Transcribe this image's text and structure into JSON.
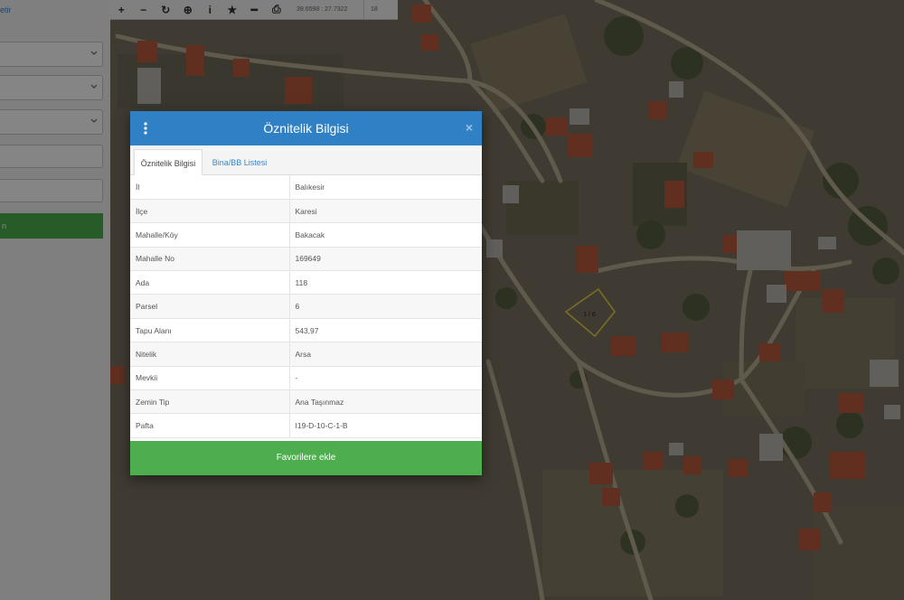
{
  "sidebar": {
    "link_label": "etir",
    "action_label": "n"
  },
  "toolbar": {
    "buttons": [
      {
        "name": "zoom-in-button",
        "glyph": "+"
      },
      {
        "name": "zoom-out-button",
        "glyph": "−"
      },
      {
        "name": "refresh-button",
        "glyph": "↻"
      },
      {
        "name": "locate-button",
        "glyph": "⊕"
      },
      {
        "name": "info-button",
        "glyph": "i"
      },
      {
        "name": "favorite-button",
        "glyph": "★"
      },
      {
        "name": "measure-button",
        "glyph": "━"
      },
      {
        "name": "print-button",
        "glyph": "⎙"
      }
    ],
    "coordinates": "39.6598 : 27.7322",
    "zoom_level": "18"
  },
  "map": {
    "parcel_label": "1 / 6"
  },
  "modal": {
    "title": "Öznitelik Bilgisi",
    "close_glyph": "×",
    "tabs": [
      {
        "label": "Öznitelik Bilgisi",
        "active": true
      },
      {
        "label": "Bina/BB Listesi",
        "active": false
      }
    ],
    "rows": [
      {
        "key": "İl",
        "value": "Balıkesir"
      },
      {
        "key": "İlçe",
        "value": "Karesi"
      },
      {
        "key": "Mahalle/Köy",
        "value": "Bakacak"
      },
      {
        "key": "Mahalle No",
        "value": "169649"
      },
      {
        "key": "Ada",
        "value": "118"
      },
      {
        "key": "Parsel",
        "value": "6"
      },
      {
        "key": "Tapu Alanı",
        "value": "543,97"
      },
      {
        "key": "Nitelik",
        "value": "Arsa"
      },
      {
        "key": "Mevkii",
        "value": "-"
      },
      {
        "key": "Zemin Tip",
        "value": "Ana Taşınmaz"
      },
      {
        "key": "Pafta",
        "value": "I19-D-10-C-1-B"
      }
    ],
    "favorite_label": "Favorilere ekle"
  },
  "colors": {
    "header_blue": "#3080c6",
    "action_green": "#4cae4c",
    "link_blue": "#3a86c8"
  }
}
